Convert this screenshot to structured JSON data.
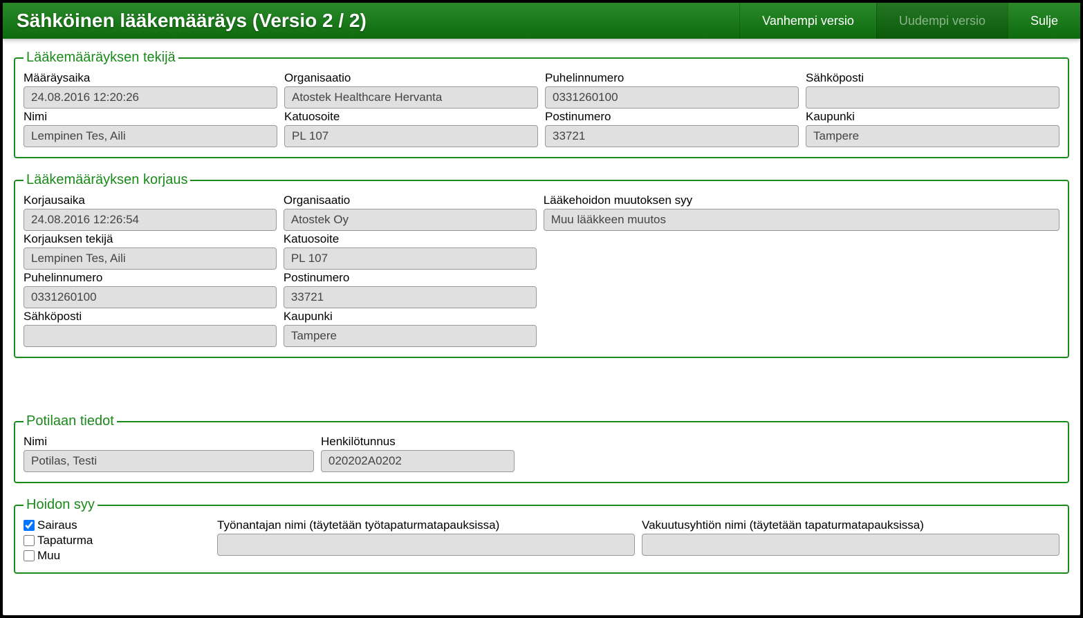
{
  "header": {
    "title": "Sähköinen lääkemääräys (Versio 2 / 2)",
    "older_version": "Vanhempi versio",
    "newer_version": "Uudempi versio",
    "close": "Sulje"
  },
  "prescriber": {
    "legend": "Lääkemääräyksen tekijä",
    "time_label": "Määräysaika",
    "time_value": "24.08.2016 12:20:26",
    "org_label": "Organisaatio",
    "org_value": "Atostek Healthcare Hervanta",
    "phone_label": "Puhelinnumero",
    "phone_value": "0331260100",
    "email_label": "Sähköposti",
    "email_value": "",
    "name_label": "Nimi",
    "name_value": "Lempinen Tes, Aili",
    "street_label": "Katuosoite",
    "street_value": "PL 107",
    "postal_label": "Postinumero",
    "postal_value": "33721",
    "city_label": "Kaupunki",
    "city_value": "Tampere"
  },
  "correction": {
    "legend": "Lääkemääräyksen korjaus",
    "time_label": "Korjausaika",
    "time_value": "24.08.2016 12:26:54",
    "org_label": "Organisaatio",
    "org_value": "Atostek Oy",
    "reason_label": "Lääkehoidon muutoksen syy",
    "reason_value": "Muu lääkkeen muutos",
    "corrector_label": "Korjauksen tekijä",
    "corrector_value": "Lempinen Tes, Aili",
    "street_label": "Katuosoite",
    "street_value": "PL 107",
    "phone_label": "Puhelinnumero",
    "phone_value": "0331260100",
    "postal_label": "Postinumero",
    "postal_value": "33721",
    "email_label": "Sähköposti",
    "email_value": "",
    "city_label": "Kaupunki",
    "city_value": "Tampere"
  },
  "patient": {
    "legend": "Potilaan tiedot",
    "name_label": "Nimi",
    "name_value": "Potilas, Testi",
    "ssn_label": "Henkilötunnus",
    "ssn_value": "020202A0202"
  },
  "treatment": {
    "legend": "Hoidon syy",
    "sickness_label": "Sairaus",
    "sickness_checked": true,
    "accident_label": "Tapaturma",
    "accident_checked": false,
    "other_label": "Muu",
    "other_checked": false,
    "employer_label": "Työnantajan nimi (täytetään työtapaturmatapauksissa)",
    "employer_value": "",
    "insurance_label": "Vakuutusyhtiön nimi (täytetään tapaturmatapauksissa)",
    "insurance_value": ""
  }
}
